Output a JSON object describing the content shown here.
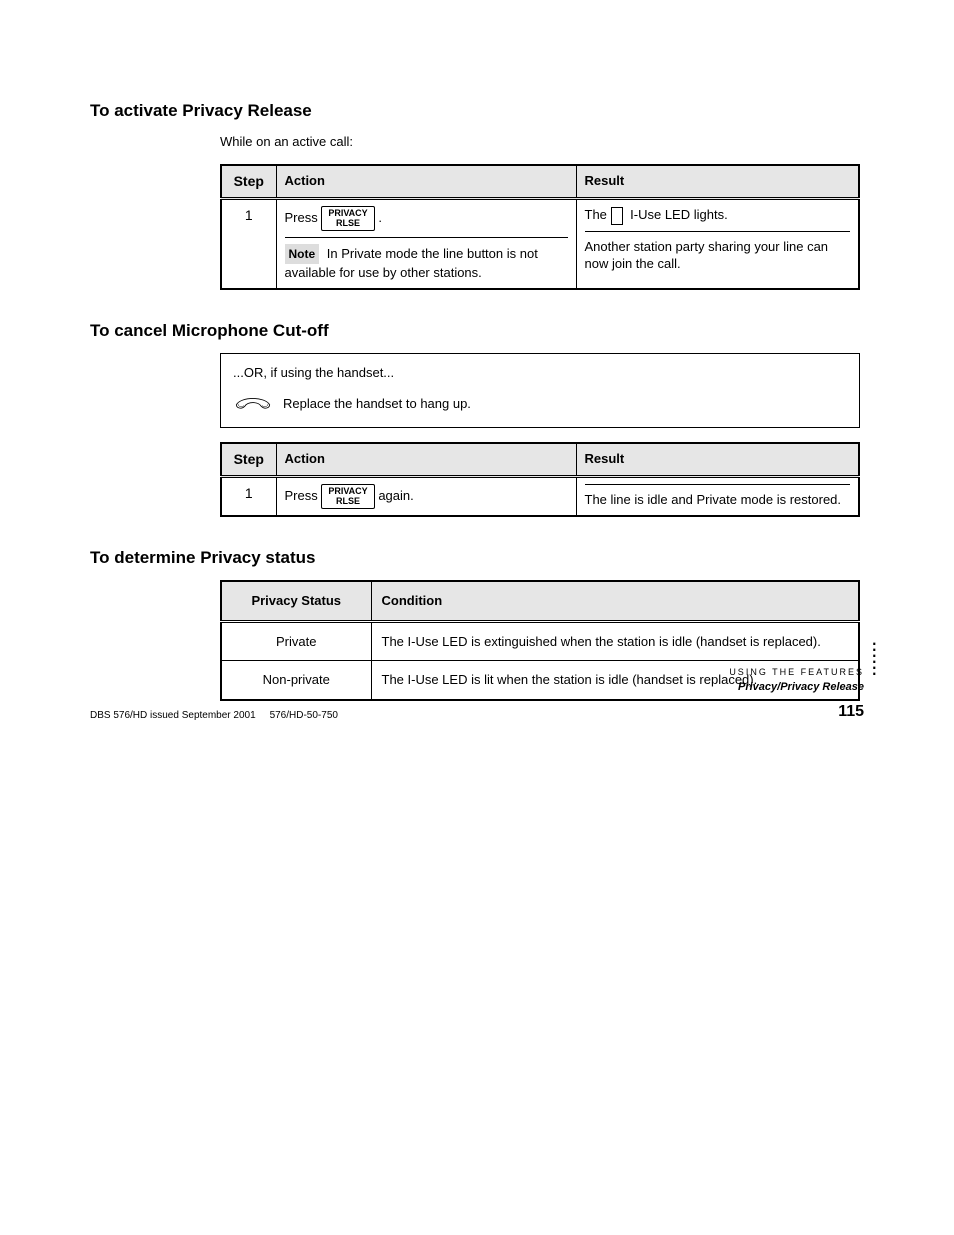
{
  "section1": {
    "title": "To activate Privacy Release",
    "lead": "While on an active call:",
    "table": {
      "headers": [
        "Step",
        "Action",
        "Result"
      ],
      "step": "1",
      "action_prefix": "Press ",
      "action_key_l1": "PRIVACY",
      "action_key_l2": "RLSE",
      "action_suffix": ".",
      "note_label": "Note",
      "note_text": "In Private mode the line button is not available for use by other stations.",
      "result_led_label": "The",
      "result_led_after": "I-Use LED lights.",
      "result_after_rule": "Another station party sharing your line can now join the call."
    }
  },
  "section2": {
    "title": "To cancel Microphone Cut-off",
    "handset": {
      "or_text": "...OR, if using the handset...",
      "to_hangup": "Replace the handset to hang up."
    },
    "table": {
      "headers": [
        "Step",
        "Action",
        "Result"
      ],
      "step": "1",
      "action_prefix": "Press ",
      "action_key_l1": "PRIVACY",
      "action_key_l2": "RLSE",
      "action_suffix": " again.",
      "result_text": "The line is idle and Private mode is restored."
    }
  },
  "section3": {
    "title": "To determine Privacy status",
    "table": {
      "headers": [
        "Privacy Status",
        "Condition"
      ],
      "rows": [
        {
          "status": "Private",
          "condition": "The I-Use LED is extinguished when the station is idle (handset is replaced)."
        },
        {
          "status": "Non-private",
          "condition": "The I-Use LED is lit when the station is idle (handset is replaced)."
        }
      ]
    }
  },
  "footer": {
    "crumb_small": "USING THE FEATURES",
    "crumb_main": "Privacy/Privacy Release",
    "page": "115",
    "doc": "DBS 576/HD issued September 2001",
    "rev": "576/HD-50-750"
  }
}
